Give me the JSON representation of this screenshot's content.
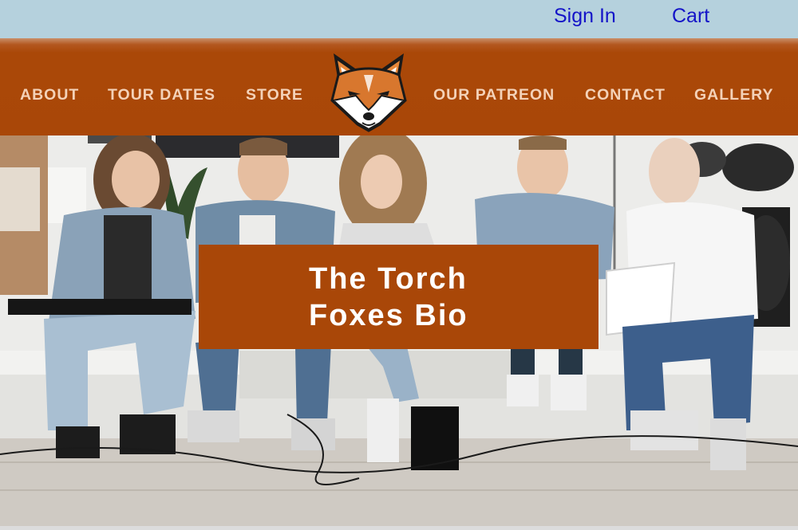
{
  "header": {
    "sign_in": "Sign In",
    "cart": "Cart"
  },
  "nav": {
    "items": [
      "ABOUT",
      "TOUR DATES",
      "STORE",
      "OUR PATREON",
      "CONTACT",
      "GALLERY"
    ],
    "logo": "fox-logo"
  },
  "hero": {
    "image": "band-photo",
    "title_line1": "The Torch",
    "title_line2": "Foxes Bio"
  },
  "colors": {
    "accent": "#a94708",
    "nav_text": "#f4d2b8",
    "top_bar": "#b5d1dd",
    "link": "#1414c8"
  }
}
